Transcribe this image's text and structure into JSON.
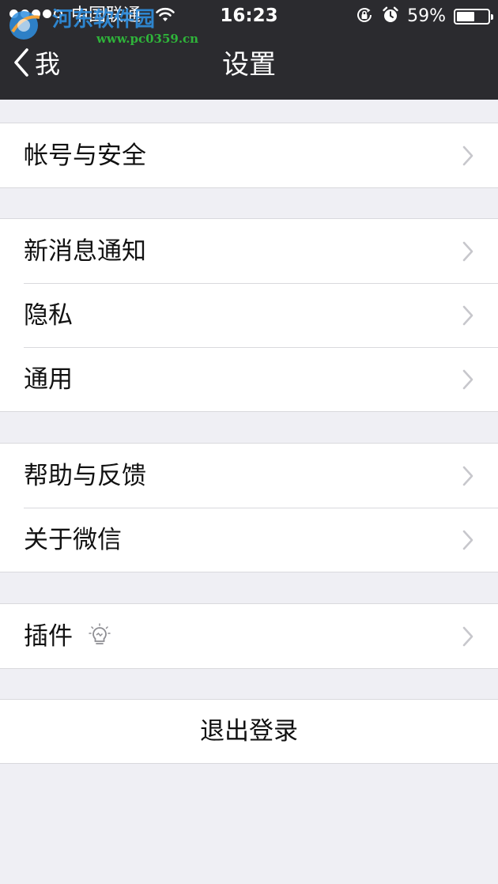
{
  "status_bar": {
    "carrier": "中国联通",
    "time": "16:23",
    "battery_percent": "59%",
    "battery_level": 0.59,
    "signal_bars_filled": 4,
    "signal_bars_total": 5,
    "icons": [
      "wifi-icon",
      "rotation-lock-icon",
      "alarm-icon",
      "battery-icon"
    ]
  },
  "watermark": {
    "name": "河东软件园",
    "url": "www.pc0359.cn"
  },
  "nav": {
    "back_label": "我",
    "title": "设置"
  },
  "groups": [
    {
      "items": [
        {
          "label": "帐号与安全"
        }
      ]
    },
    {
      "items": [
        {
          "label": "新消息通知"
        },
        {
          "label": "隐私"
        },
        {
          "label": "通用"
        }
      ]
    },
    {
      "items": [
        {
          "label": "帮助与反馈"
        },
        {
          "label": "关于微信"
        }
      ]
    },
    {
      "items": [
        {
          "label": "插件",
          "icon": "lightbulb-icon"
        }
      ]
    }
  ],
  "logout": {
    "label": "退出登录"
  },
  "colors": {
    "header_bg": "#2B2B2F",
    "page_bg": "#EFEFF4",
    "cell_bg": "#FFFFFF",
    "separator": "#D9D9DD",
    "chevron": "#C7C7CC"
  }
}
